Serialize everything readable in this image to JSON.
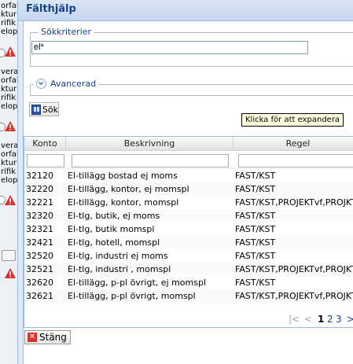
{
  "background": {
    "group1": [
      "orfal",
      "ktur",
      "rifik",
      "elopp"
    ],
    "group2": [
      "vera",
      "orfal",
      "ktur",
      "rifik",
      "elopp"
    ],
    "group3": [
      "vera",
      "orfal",
      "ktur",
      "rifik",
      "elopp"
    ]
  },
  "dialog": {
    "title": "Fälthjälp",
    "criteria_legend": "Sökkriterier",
    "search_value": "el*",
    "advanced_label": "Avancerad",
    "search_button": "Sök",
    "tooltip": "Klicka för att expandera",
    "close_button": "Stäng"
  },
  "grid": {
    "columns": [
      "Konto",
      "Beskrivning",
      "Regel"
    ],
    "rows": [
      [
        "32120",
        "El-tillägg bostad ej moms",
        "FAST/KST"
      ],
      [
        "32220",
        "El-tillägg, kontor, ej momspl",
        "FAST/KST"
      ],
      [
        "32221",
        "El-tillägg, kontor, momspl",
        "FAST/KST,PROJEKTvf,PROJKT"
      ],
      [
        "32320",
        "El-tlg, butik, ej moms",
        "FAST/KST"
      ],
      [
        "32321",
        "El-tlg, butik momspl",
        "FAST/KST"
      ],
      [
        "32421",
        "El-tlg, hotell, momspl",
        "FAST/KST"
      ],
      [
        "32520",
        "El-tlg, industri ej moms",
        "FAST/KST"
      ],
      [
        "32521",
        "El-tlg, industri , momspl",
        "FAST/KST,PROJEKTvf,PROJKTO"
      ],
      [
        "32620",
        "El-tillägg, p-pl övrigt, ej momspl",
        "FAST/KST"
      ],
      [
        "32621",
        "El-tillägg, p-pl övrigt, momspl",
        "FAST/KST,PROJEKTvf,PROJKTO"
      ]
    ]
  },
  "pager": {
    "first": "|<",
    "prev": "<",
    "page1": "1",
    "page2": "2",
    "page3": "3",
    "next": ">"
  },
  "icons": {
    "warning": "warning-icon",
    "search": "search-icon",
    "close": "close-icon",
    "chevron": "chevron-down-icon"
  },
  "colors": {
    "title": "#15428b",
    "border": "#99bbe8",
    "warning": "#d9302a"
  }
}
